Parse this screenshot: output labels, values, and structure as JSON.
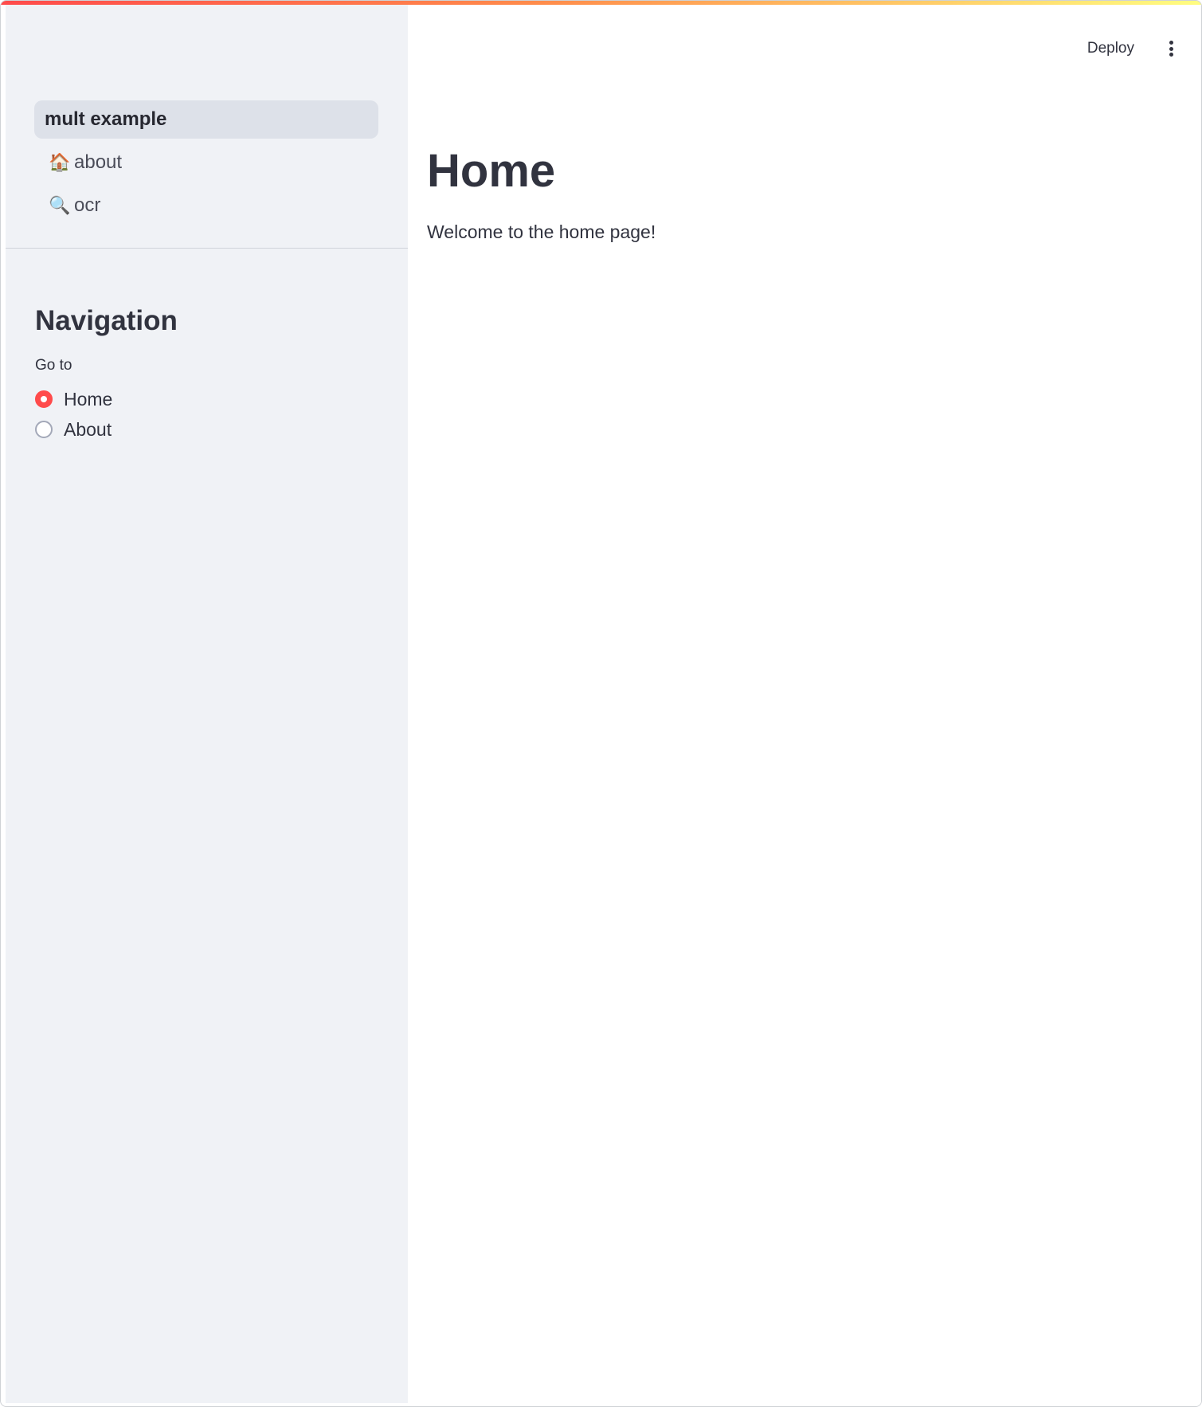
{
  "sidebar": {
    "pages": [
      {
        "label": "mult example",
        "emoji": "",
        "active": true
      },
      {
        "label": "about",
        "emoji": "🏠",
        "active": false
      },
      {
        "label": "ocr",
        "emoji": "🔍",
        "active": false
      }
    ],
    "heading": "Navigation",
    "radio": {
      "label": "Go to",
      "options": [
        "Home",
        "About"
      ],
      "selected": "Home"
    }
  },
  "header": {
    "deploy_label": "Deploy",
    "menu_icon": "kebab-menu-icon"
  },
  "main": {
    "title": "Home",
    "text": "Welcome to the home page!"
  },
  "colors": {
    "accent": "#ff4b4b",
    "sidebar_bg": "#f0f2f6",
    "active_item_bg": "#dde1e9",
    "text": "#31333f"
  }
}
